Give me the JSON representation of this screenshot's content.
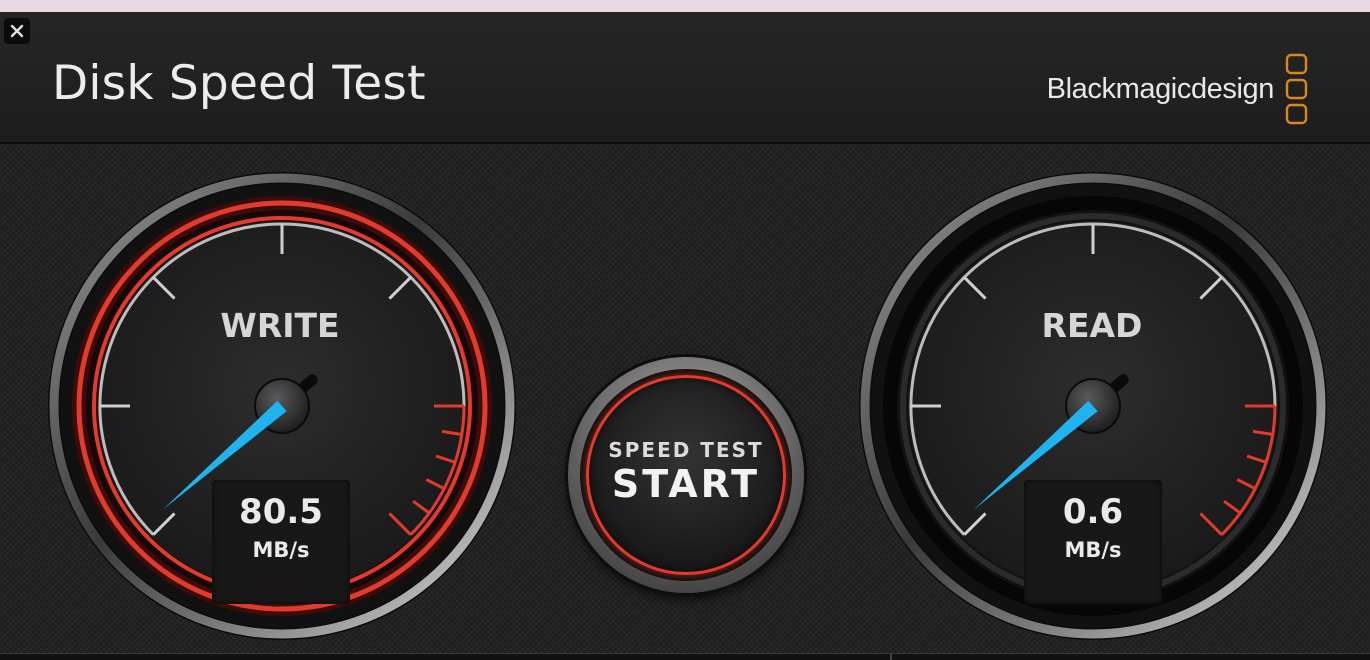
{
  "window": {
    "title": "Disk Speed Test",
    "brand": "Blackmagicdesign"
  },
  "icons": {
    "close": "close-icon",
    "settings": "gear-icon",
    "brand_mark": "blackmagic-logo-icon"
  },
  "colors": {
    "accent_red": "#e23b2b",
    "needle_blue": "#1fb4f0",
    "brand_orange": "#d9891c"
  },
  "write_gauge": {
    "label": "WRITE",
    "value": "80.5",
    "unit": "MB/s",
    "active": true
  },
  "read_gauge": {
    "label": "READ",
    "value": "0.6",
    "unit": "MB/s",
    "active": false
  },
  "start_button": {
    "line1": "SPEED TEST",
    "line2": "START"
  }
}
